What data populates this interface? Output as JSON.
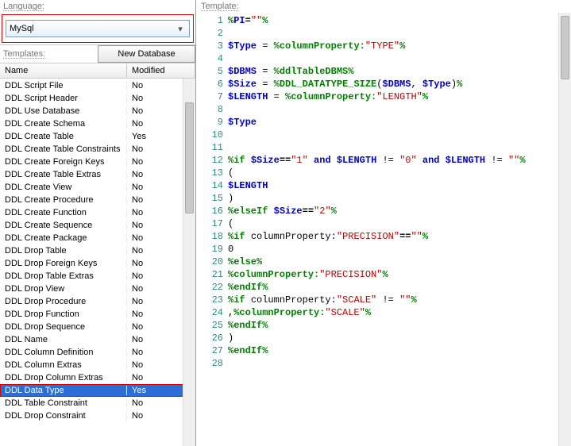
{
  "labels": {
    "language": "Language:",
    "templates": "Templates:",
    "new_database": "New Database",
    "template": "Template:",
    "col_name": "Name",
    "col_modified": "Modified"
  },
  "language_combo": {
    "value": "MySql"
  },
  "template_rows": [
    {
      "name": "DDL Script File",
      "modified": "No",
      "sel": false
    },
    {
      "name": "DDL Script Header",
      "modified": "No",
      "sel": false
    },
    {
      "name": "DDL Use Database",
      "modified": "No",
      "sel": false
    },
    {
      "name": "DDL Create Schema",
      "modified": "No",
      "sel": false
    },
    {
      "name": "DDL Create Table",
      "modified": "Yes",
      "sel": false
    },
    {
      "name": "DDL Create Table Constraints",
      "modified": "No",
      "sel": false
    },
    {
      "name": "DDL Create Foreign Keys",
      "modified": "No",
      "sel": false
    },
    {
      "name": "DDL Create Table Extras",
      "modified": "No",
      "sel": false
    },
    {
      "name": "DDL Create View",
      "modified": "No",
      "sel": false
    },
    {
      "name": "DDL Create Procedure",
      "modified": "No",
      "sel": false
    },
    {
      "name": "DDL Create Function",
      "modified": "No",
      "sel": false
    },
    {
      "name": "DDL Create Sequence",
      "modified": "No",
      "sel": false
    },
    {
      "name": "DDL Create Package",
      "modified": "No",
      "sel": false
    },
    {
      "name": "DDL Drop Table",
      "modified": "No",
      "sel": false
    },
    {
      "name": "DDL Drop Foreign Keys",
      "modified": "No",
      "sel": false
    },
    {
      "name": "DDL Drop Table Extras",
      "modified": "No",
      "sel": false
    },
    {
      "name": "DDL Drop View",
      "modified": "No",
      "sel": false
    },
    {
      "name": "DDL Drop Procedure",
      "modified": "No",
      "sel": false
    },
    {
      "name": "DDL Drop Function",
      "modified": "No",
      "sel": false
    },
    {
      "name": "DDL Drop Sequence",
      "modified": "No",
      "sel": false
    },
    {
      "name": "DDL Name",
      "modified": "No",
      "sel": false
    },
    {
      "name": "DDL Column Definition",
      "modified": "No",
      "sel": false
    },
    {
      "name": "DDL Column Extras",
      "modified": "No",
      "sel": false
    },
    {
      "name": "DDL Drop Column Extras",
      "modified": "No",
      "sel": false
    },
    {
      "name": "DDL Data Type",
      "modified": "Yes",
      "sel": true,
      "hl": true
    },
    {
      "name": "DDL Table Constraint",
      "modified": "No",
      "sel": false
    },
    {
      "name": "DDL Drop Constraint",
      "modified": "No",
      "sel": false
    }
  ],
  "code_lines": [
    [
      {
        "t": "pct",
        "v": "%"
      },
      {
        "t": "var",
        "v": "PI"
      },
      {
        "t": "op",
        "v": "="
      },
      {
        "t": "str",
        "v": "\"\""
      },
      {
        "t": "pct",
        "v": "%"
      }
    ],
    [],
    [
      {
        "t": "var",
        "v": "$Type"
      },
      {
        "t": "plain",
        "v": " = "
      },
      {
        "t": "pctkw",
        "v": "%columnProperty:"
      },
      {
        "t": "str",
        "v": "\"TYPE\""
      },
      {
        "t": "pct",
        "v": "%"
      }
    ],
    [],
    [
      {
        "t": "var",
        "v": "$DBMS"
      },
      {
        "t": "plain",
        "v": " = "
      },
      {
        "t": "pctkw",
        "v": "%ddlTableDBMS%"
      }
    ],
    [
      {
        "t": "var",
        "v": "$Size"
      },
      {
        "t": "plain",
        "v": " = "
      },
      {
        "t": "pctkw",
        "v": "%DDL_DATATYPE_SIZE"
      },
      {
        "t": "plain",
        "v": "("
      },
      {
        "t": "var",
        "v": "$DBMS"
      },
      {
        "t": "plain",
        "v": ", "
      },
      {
        "t": "var",
        "v": "$Type"
      },
      {
        "t": "plain",
        "v": ")"
      },
      {
        "t": "pct",
        "v": "%"
      }
    ],
    [
      {
        "t": "var",
        "v": "$LENGTH"
      },
      {
        "t": "plain",
        "v": " = "
      },
      {
        "t": "pctkw",
        "v": "%columnProperty:"
      },
      {
        "t": "str",
        "v": "\"LENGTH\""
      },
      {
        "t": "pct",
        "v": "%"
      }
    ],
    [],
    [
      {
        "t": "var",
        "v": "$Type"
      }
    ],
    [],
    [],
    [
      {
        "t": "pctkw",
        "v": "%if"
      },
      {
        "t": "plain",
        "v": " "
      },
      {
        "t": "var",
        "v": "$Size"
      },
      {
        "t": "op",
        "v": "=="
      },
      {
        "t": "str",
        "v": "\"1\""
      },
      {
        "t": "plain",
        "v": " "
      },
      {
        "t": "kw",
        "v": "and"
      },
      {
        "t": "plain",
        "v": " "
      },
      {
        "t": "var",
        "v": "$LENGTH"
      },
      {
        "t": "plain",
        "v": " != "
      },
      {
        "t": "str",
        "v": "\"0\""
      },
      {
        "t": "plain",
        "v": " "
      },
      {
        "t": "kw",
        "v": "and"
      },
      {
        "t": "plain",
        "v": " "
      },
      {
        "t": "var",
        "v": "$LENGTH"
      },
      {
        "t": "plain",
        "v": " != "
      },
      {
        "t": "str",
        "v": "\"\""
      },
      {
        "t": "pct",
        "v": "%"
      }
    ],
    [
      {
        "t": "plain",
        "v": "("
      }
    ],
    [
      {
        "t": "var",
        "v": "$LENGTH"
      }
    ],
    [
      {
        "t": "plain",
        "v": ")"
      }
    ],
    [
      {
        "t": "pctkw",
        "v": "%elseIf"
      },
      {
        "t": "plain",
        "v": " "
      },
      {
        "t": "var",
        "v": "$Size"
      },
      {
        "t": "op",
        "v": "=="
      },
      {
        "t": "str",
        "v": "\"2\""
      },
      {
        "t": "pct",
        "v": "%"
      }
    ],
    [
      {
        "t": "plain",
        "v": "("
      }
    ],
    [
      {
        "t": "pctkw",
        "v": "%if"
      },
      {
        "t": "plain",
        "v": " "
      },
      {
        "t": "prop",
        "v": "columnProperty:"
      },
      {
        "t": "str",
        "v": "\"PRECISION\""
      },
      {
        "t": "op",
        "v": "=="
      },
      {
        "t": "str",
        "v": "\"\""
      },
      {
        "t": "pct",
        "v": "%"
      }
    ],
    [
      {
        "t": "plain",
        "v": "0"
      }
    ],
    [
      {
        "t": "pctkw",
        "v": "%else%"
      }
    ],
    [
      {
        "t": "pctkw",
        "v": "%columnProperty:"
      },
      {
        "t": "str",
        "v": "\"PRECISION\""
      },
      {
        "t": "pct",
        "v": "%"
      }
    ],
    [
      {
        "t": "pctkw",
        "v": "%endIf%"
      }
    ],
    [
      {
        "t": "pctkw",
        "v": "%if"
      },
      {
        "t": "plain",
        "v": " "
      },
      {
        "t": "prop",
        "v": "columnProperty:"
      },
      {
        "t": "str",
        "v": "\"SCALE\""
      },
      {
        "t": "plain",
        "v": " != "
      },
      {
        "t": "str",
        "v": "\"\""
      },
      {
        "t": "pct",
        "v": "%"
      }
    ],
    [
      {
        "t": "plain",
        "v": ","
      },
      {
        "t": "pctkw",
        "v": "%columnProperty:"
      },
      {
        "t": "str",
        "v": "\"SCALE\""
      },
      {
        "t": "pct",
        "v": "%"
      }
    ],
    [
      {
        "t": "pctkw",
        "v": "%endIf%"
      }
    ],
    [
      {
        "t": "plain",
        "v": ")"
      }
    ],
    [
      {
        "t": "pctkw",
        "v": "%endIf%"
      }
    ],
    []
  ]
}
